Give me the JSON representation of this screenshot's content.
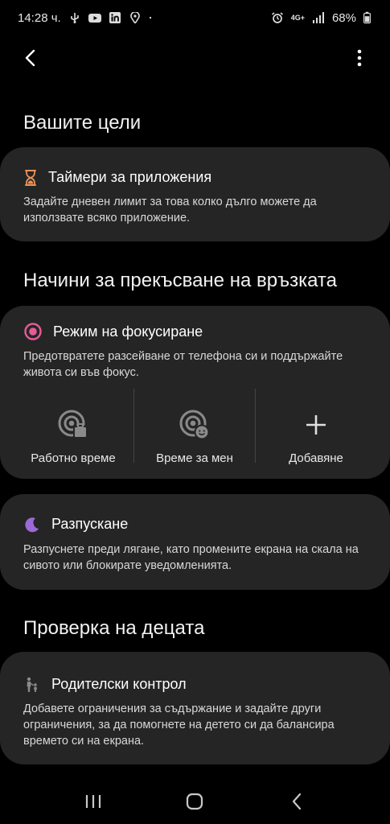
{
  "status_bar": {
    "time": "14:28 ч.",
    "network": "4G+",
    "battery": "68%",
    "icons": [
      "usb-icon",
      "youtube-icon",
      "linkedin-icon",
      "location-pin-icon",
      "dot-icon",
      "alarm-icon",
      "signal-icon",
      "battery-icon"
    ]
  },
  "toolbar": {
    "back_icon": "chevron-left-icon",
    "more_icon": "more-vertical-icon"
  },
  "sections": {
    "goals_title": "Вашите цели",
    "disconnect_title": "Начини за прекъсване на връзката",
    "kids_title": "Проверка на децата"
  },
  "app_timers": {
    "icon": "hourglass-icon",
    "title": "Таймери за приложения",
    "description": "Задайте дневен лимит за това колко дълго можете да използвате всяко приложение."
  },
  "focus_mode": {
    "icon": "target-icon",
    "title": "Режим на фокусиране",
    "description": "Предотвратете разсейване от телефона си и поддържайте живота си във фокус.",
    "options": [
      {
        "label": "Работно време",
        "icon": "focus-work-icon"
      },
      {
        "label": "Време за мен",
        "icon": "focus-me-icon"
      },
      {
        "label": "Добавяне",
        "icon": "plus-icon"
      }
    ]
  },
  "wind_down": {
    "icon": "moon-icon",
    "title": "Разпускане",
    "description": "Разпуснете преди лягане, като промените екрана на скала на сивото или блокирате уведомленията."
  },
  "parental": {
    "icon": "parent-child-icon",
    "title": "Родителски контрол",
    "description": "Добавете ограничения за съдържание и задайте други ограничения, за да помогнете на детето си да балансира времето си на екрана."
  },
  "nav": {
    "recents_icon": "recents-icon",
    "home_icon": "home-icon",
    "back_icon": "back-icon"
  },
  "colors": {
    "background": "#000000",
    "card": "#252525",
    "hourglass": "#e8935a",
    "target": "#e45c96",
    "moon": "#9c6ad6",
    "icon_gray": "#8a8a8a"
  }
}
